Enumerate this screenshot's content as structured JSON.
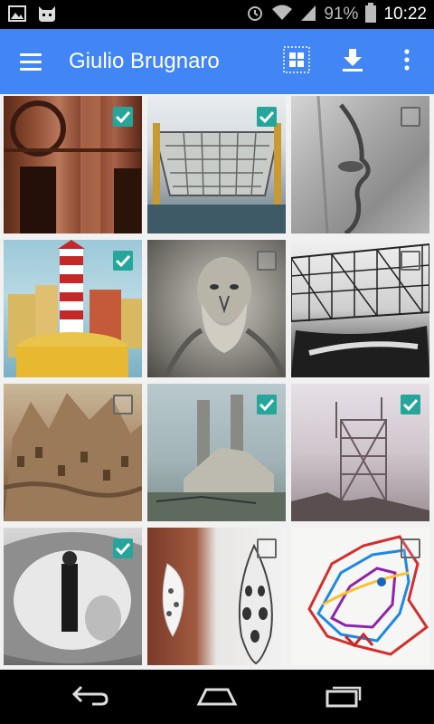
{
  "status_bar": {
    "battery": "91%",
    "time": "10:22",
    "icons": [
      "image-notification-icon",
      "cyanogen-notification-icon",
      "alarm-icon",
      "wifi-icon",
      "signal-icon",
      "battery-icon"
    ]
  },
  "app_bar": {
    "title": "Giulio Brugnaro",
    "color": "#4285f4",
    "actions": [
      "grid-view-icon",
      "download-icon",
      "more-vert-icon"
    ]
  },
  "gallery": {
    "checkbox_color": "#26a69a",
    "items": [
      {
        "subject": "carved-facade",
        "selected": true
      },
      {
        "subject": "ship-hull-structure",
        "selected": true
      },
      {
        "subject": "stone-face-sculpture",
        "selected": false
      },
      {
        "subject": "striped-tower-architecture",
        "selected": true
      },
      {
        "subject": "bearded-bust-sculpture",
        "selected": false
      },
      {
        "subject": "steel-truss-structure",
        "selected": false
      },
      {
        "subject": "fantastic-city-painting",
        "selected": false
      },
      {
        "subject": "twin-chimneys-ruin",
        "selected": true
      },
      {
        "subject": "radio-tower-scaffold",
        "selected": true
      },
      {
        "subject": "futuristic-interior-woman",
        "selected": true
      },
      {
        "subject": "lattice-earring",
        "selected": false
      },
      {
        "subject": "colorful-wolf-drawing",
        "selected": false
      }
    ]
  },
  "nav_bar": {
    "buttons": [
      "back-icon",
      "home-icon",
      "recents-icon"
    ]
  }
}
